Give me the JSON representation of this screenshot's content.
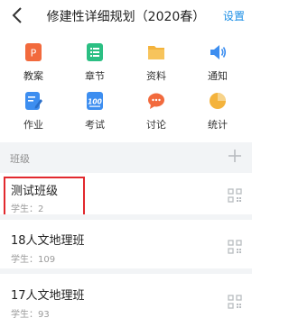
{
  "header": {
    "title": "修建性详细规划（2020春）",
    "settings_label": "设置"
  },
  "grid": [
    {
      "label": "教案",
      "icon": "document-icon",
      "color": "#f26a3d"
    },
    {
      "label": "章节",
      "icon": "list-icon",
      "color": "#2bbf83"
    },
    {
      "label": "资料",
      "icon": "folder-icon",
      "color": "#f4b33c"
    },
    {
      "label": "通知",
      "icon": "speaker-icon",
      "color": "#3d8ef0"
    },
    {
      "label": "作业",
      "icon": "edit-icon",
      "color": "#3d8ef0"
    },
    {
      "label": "考试",
      "icon": "exam-icon",
      "color": "#3d8ef0"
    },
    {
      "label": "讨论",
      "icon": "chat-icon",
      "color": "#f26a3d"
    },
    {
      "label": "统计",
      "icon": "pie-chart-icon",
      "color": "#f4b33c"
    }
  ],
  "section": {
    "label": "班级"
  },
  "classes": [
    {
      "name": "测试班级",
      "students": "学生：2"
    },
    {
      "name": "18人文地理班",
      "students": "学生：109"
    },
    {
      "name": "17人文地理班",
      "students": "学生：93"
    }
  ]
}
